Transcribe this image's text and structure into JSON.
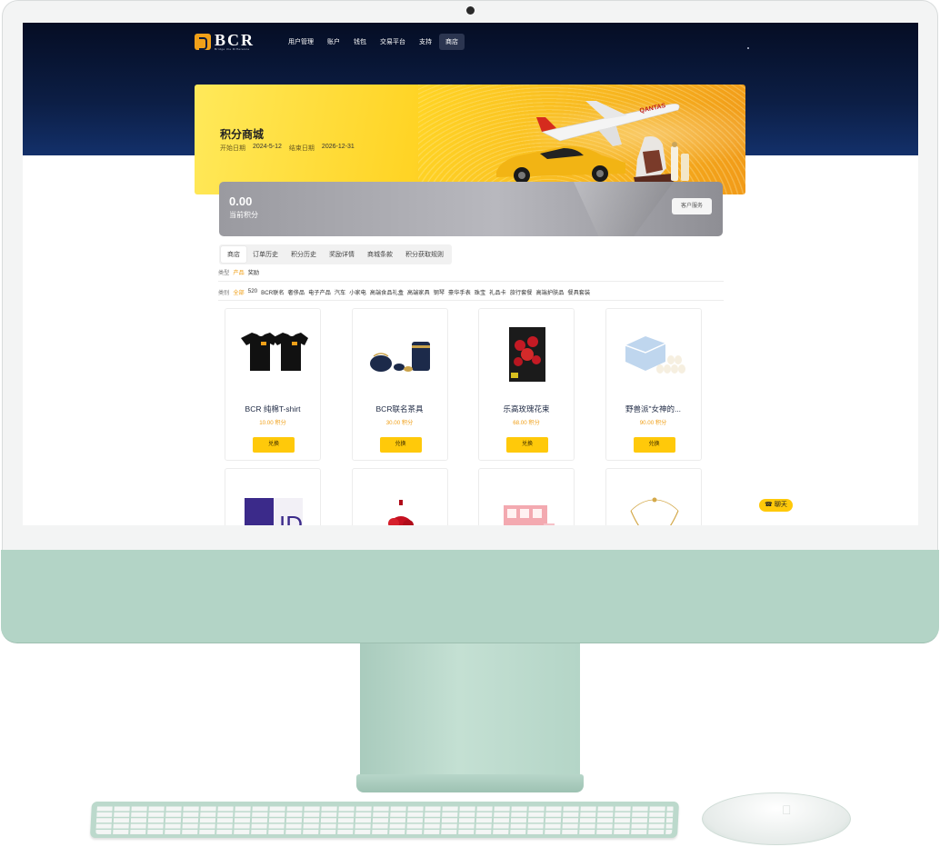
{
  "nav": {
    "logo_text": "BCR",
    "logo_sub": "Bridge the Difference",
    "items": [
      "用户管理",
      "账户",
      "钱包",
      "交易平台",
      "支持",
      "商店"
    ]
  },
  "banner": {
    "title": "积分商城",
    "start_label": "开始日期",
    "start_date": "2024-5-12",
    "end_label": "结束日期",
    "end_date": "2026-12-31",
    "plane_text": "QANTAS"
  },
  "points": {
    "value": "0.00",
    "label": "当前积分",
    "service_button": "客户服务"
  },
  "tabs": [
    "商店",
    "订单历史",
    "积分历史",
    "奖励详情",
    "商城条款",
    "积分获取规则"
  ],
  "filters": {
    "type_label": "类型",
    "types": [
      "产品",
      "奖励"
    ],
    "category_label": "类别",
    "categories": [
      "全部",
      "520",
      "BCR联名",
      "奢侈品",
      "电子产品",
      "汽车",
      "小家电",
      "高端食品礼盒",
      "高端家具",
      "钢琴",
      "豪华手表",
      "珠宝",
      "礼品卡",
      "旅行套餐",
      "高端护肤品",
      "餐具套装"
    ]
  },
  "products": [
    {
      "name": "BCR 纯棉T-shirt",
      "price": "10.00",
      "unit": "积分",
      "button": "兑换"
    },
    {
      "name": "BCR联名茶具",
      "price": "30.00",
      "unit": "积分",
      "button": "兑换"
    },
    {
      "name": "乐高玫瑰花束",
      "price": "68.00",
      "unit": "积分",
      "button": "兑换"
    },
    {
      "name": "野兽派\"女神的...",
      "price": "90.00",
      "unit": "积分",
      "button": "兑换"
    }
  ],
  "chat": {
    "label": "聊天"
  },
  "colors": {
    "accent": "#ffc90a",
    "price": "#f0a019",
    "header_dark": "#0c1e45"
  }
}
